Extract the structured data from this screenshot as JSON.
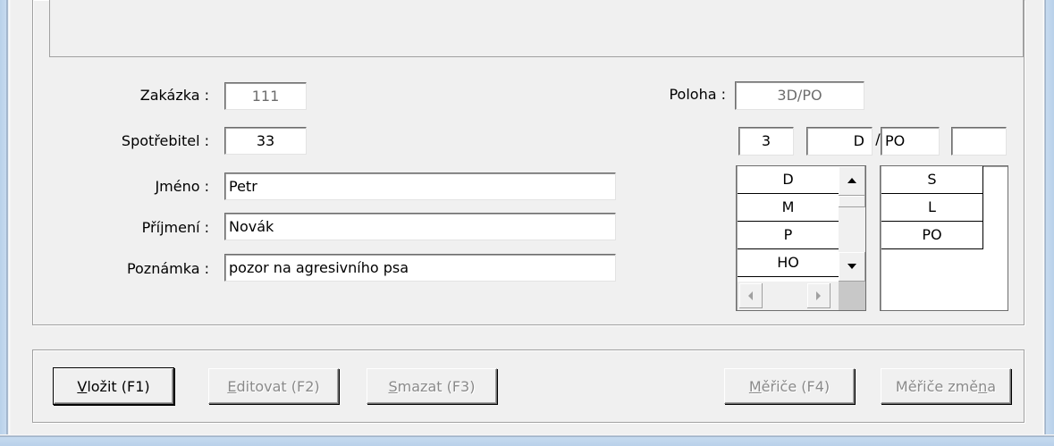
{
  "form": {
    "zakazka_label": "Zakázka :",
    "zakazka_value": "111",
    "spotrebitel_label": "Spotřebitel :",
    "spotrebitel_value": "33",
    "jmeno_label": "Jméno :",
    "jmeno_value": "Petr",
    "prijmeni_label": "Příjmení :",
    "prijmeni_value": "Novák",
    "poznamka_label": "Poznámka :",
    "poznamka_value": "pozor na agresivního psa"
  },
  "poloha": {
    "label": "Poloha :",
    "value": "3D/PO",
    "part1": "3",
    "part2": "D",
    "separator": "/",
    "part3": "PO",
    "part4": "",
    "list_left": [
      "D",
      "M",
      "P",
      "HO"
    ],
    "list_right": [
      "S",
      "L",
      "PO"
    ]
  },
  "buttons": {
    "vlozit": {
      "mnemonic": "V",
      "rest": "ložit (F1)",
      "enabled": true
    },
    "editovat": {
      "mnemonic": "E",
      "rest": "ditovat (F2)",
      "enabled": false
    },
    "smazat": {
      "mnemonic": "S",
      "rest": "mazat (F3)",
      "enabled": false
    },
    "merice": {
      "mnemonic": "M",
      "rest": "ěřiče (F4)",
      "enabled": false
    },
    "merice_zmena": {
      "before": "Měřiče změ",
      "mnemonic": "n",
      "after": "a",
      "enabled": false
    }
  },
  "colors": {
    "dialog_bg": "#f0f0f0",
    "frame": "#b9d1ea",
    "disabled_text": "#8a8a8a",
    "readonly_text": "#6d6d6d"
  }
}
